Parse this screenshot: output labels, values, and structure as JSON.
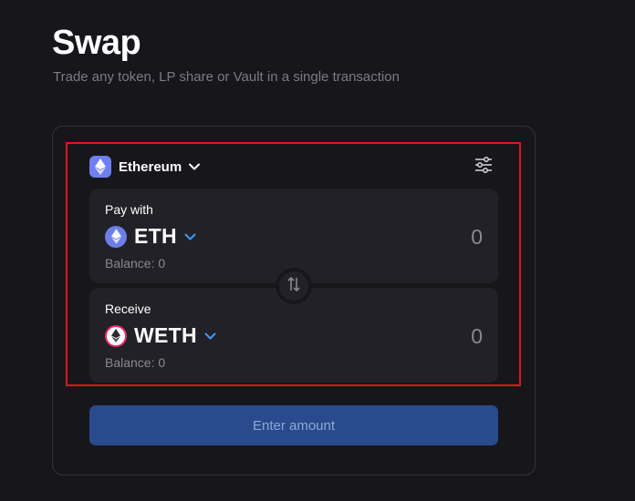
{
  "header": {
    "title": "Swap",
    "subtitle": "Trade any token, LP share or Vault in a single transaction"
  },
  "network": {
    "label": "Ethereum",
    "icon": "ethereum-icon"
  },
  "settings": {
    "icon": "sliders-icon"
  },
  "pay": {
    "label": "Pay with",
    "token": "ETH",
    "token_icon": "eth-icon",
    "amount": "0",
    "balance": "Balance: 0"
  },
  "receive": {
    "label": "Receive",
    "token": "WETH",
    "token_icon": "weth-icon",
    "amount": "0",
    "balance": "Balance: 0"
  },
  "switch": {
    "icon": "swap-arrows-icon"
  },
  "cta": {
    "label": "Enter amount"
  },
  "colors": {
    "background": "#17161b",
    "panel": "#222127",
    "accent_blue": "#3b9cf5",
    "cta_bg": "#294a8d",
    "highlight": "#e0161b",
    "eth_badge": "#6c7ee8",
    "weth_ring": "#ee2a6b"
  }
}
